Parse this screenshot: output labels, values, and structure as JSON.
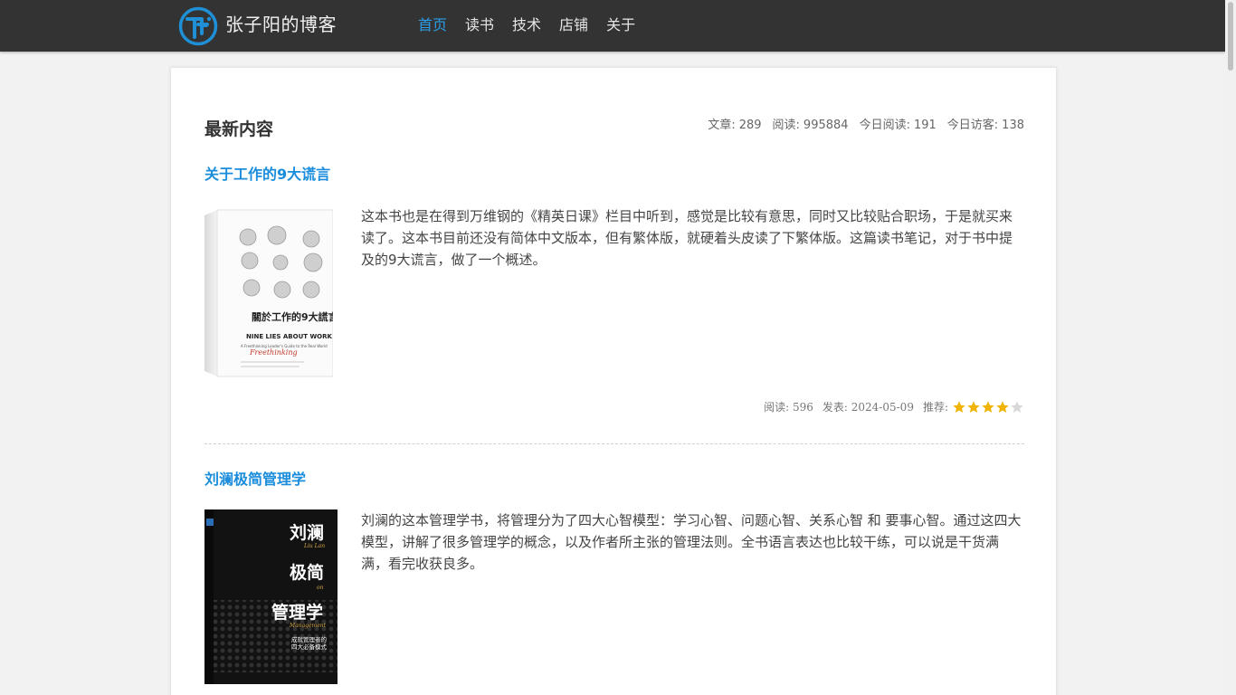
{
  "header": {
    "site_title": "张子阳的博客",
    "logo_icon": "tf-logo-icon",
    "nav": [
      {
        "label": "首页",
        "active": true
      },
      {
        "label": "读书",
        "active": false
      },
      {
        "label": "技术",
        "active": false
      },
      {
        "label": "店铺",
        "active": false
      },
      {
        "label": "关于",
        "active": false
      }
    ],
    "accent_color": "#2a9ee8"
  },
  "main": {
    "section_title": "最新内容",
    "stats": [
      {
        "label": "文章:",
        "value": "289"
      },
      {
        "label": "阅读:",
        "value": "995884"
      },
      {
        "label": "今日阅读:",
        "value": "191"
      },
      {
        "label": "今日访客:",
        "value": "138"
      }
    ],
    "posts": [
      {
        "title": "关于工作的9大谎言",
        "excerpt": "这本书也是在得到万维钢的《精英日课》栏目中听到，感觉是比较有意思，同时又比较贴合职场，于是就买来读了。这本书目前还没有简体中文版本，但有繁体版，就硬着头皮读了下繁体版。这篇读书笔记，对于书中提及的9大谎言，做了一个概述。",
        "reads_label": "阅读:",
        "reads": "596",
        "date_label": "发表:",
        "date": "2024-05-09",
        "rating_label": "推荐:",
        "rating": 4,
        "rating_max": 5,
        "cover": {
          "top_label": "關於工作的9大謊言",
          "en_title": "NINE LIES ABOUT WORK",
          "subtitle": "A Freethinking Leader's Guide to the Real World",
          "script": "Freethinking"
        }
      },
      {
        "title": "刘澜极简管理学",
        "excerpt": "刘澜的这本管理学书，将管理分为了四大心智模型：学习心智、问题心智、关系心智 和 要事心智。通过这四大模型，讲解了很多管理学的概念，以及作者所主张的管理法则。全书语言表达也比较干练，可以说是干货满满，看完收获良多。",
        "cover": {
          "line1": "刘澜",
          "line1_en": "Liu Lan",
          "line2": "极简",
          "line2_en": "on",
          "line3": "管理学",
          "line3_en": "Management",
          "tagline1": "成就管理者的",
          "tagline2": "四大必备模式"
        }
      }
    ]
  },
  "colors": {
    "header_bg": "#333333",
    "link": "#1a8cdc",
    "star": "#f0b400",
    "star_empty": "#d8d8d8"
  }
}
